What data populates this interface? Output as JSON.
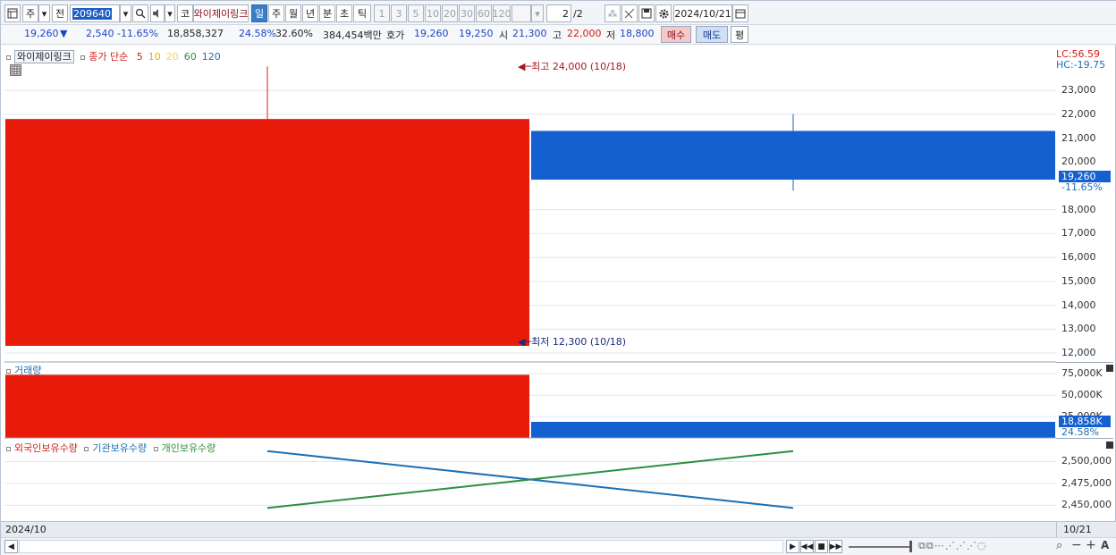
{
  "toolbar": {
    "market_type": "주",
    "prev_label": "전",
    "code": "209640",
    "name_prefix": "코",
    "stock_name": "와이제이링크",
    "periods": [
      "일",
      "주",
      "월",
      "년",
      "분",
      "초",
      "틱"
    ],
    "active_period": "일",
    "intervals": [
      "1",
      "3",
      "5",
      "10",
      "20",
      "30",
      "60",
      "120"
    ],
    "page": "2",
    "page_total": "/2",
    "date": "2024/10/21"
  },
  "quote": {
    "price": "19,260",
    "change_arrow": "▼",
    "change": "2,540",
    "change_pct": "-11.65%",
    "volume": "18,858,327",
    "turnover_pct": "24.58%",
    "ratio_pct": "32.60%",
    "amount": "384,454백만",
    "bid_label": "호가",
    "bid1": "19,260",
    "bid2": "19,250",
    "open_label": "시",
    "open": "21,300",
    "high_label": "고",
    "high": "22,000",
    "low_label": "저",
    "low": "18,800",
    "buy_label": "매수",
    "sell_label": "매도",
    "avg_label": "평"
  },
  "price_panel": {
    "legend_name": "와이제이링크",
    "legend_series": "종가 단순",
    "ma": [
      {
        "label": "5",
        "color": "#d0201c"
      },
      {
        "label": "10",
        "color": "#e3b400"
      },
      {
        "label": "20",
        "color": "#f0d84a"
      },
      {
        "label": "60",
        "color": "#2b8f3f"
      },
      {
        "label": "120",
        "color": "#1b6fb5"
      }
    ],
    "high_note": "최고 24,000 (10/18)",
    "low_note": "최저 12,300 (10/18)",
    "lc": "LC:56.59",
    "hc": "HC:-19.75",
    "current_price_tag": "19,260",
    "current_pct_tag": "-11.65%",
    "y_ticks": [
      "23,000",
      "22,000",
      "21,000",
      "20,000",
      "18,000",
      "17,000",
      "16,000",
      "15,000",
      "14,000",
      "13,000",
      "12,000"
    ]
  },
  "volume_panel": {
    "title": "거래량",
    "y_ticks": [
      "75,000K",
      "50,000K",
      "25,000K"
    ],
    "current_tag": "18,858K",
    "current_pct": "24.58%"
  },
  "holdings_panel": {
    "series": [
      {
        "label": "외국인보유수량",
        "color": "#d0201c"
      },
      {
        "label": "기관보유수량",
        "color": "#1b6fb5"
      },
      {
        "label": "개인보유수량",
        "color": "#2b8f3f"
      }
    ],
    "y_ticks": [
      "2,500,000",
      "2,475,000",
      "2,450,000"
    ]
  },
  "date_axis": {
    "left": "2024/10",
    "right": "10/21"
  },
  "chart_data": {
    "type": "candlestick",
    "dates": [
      "10/18",
      "10/21"
    ],
    "candles": [
      {
        "date": "10/18",
        "open": 12300,
        "high": 24000,
        "low": 12300,
        "close": 21800,
        "color": "#e81a0a"
      },
      {
        "date": "10/21",
        "open": 21300,
        "high": 22000,
        "low": 18800,
        "close": 19260,
        "color": "#1560d0"
      }
    ],
    "ylim": [
      11700,
      24800
    ],
    "volume": {
      "values": [
        74000,
        18858
      ],
      "ylim": [
        0,
        88000
      ]
    },
    "holdings": {
      "institution": [
        2512000,
        2447000
      ],
      "individual": [
        2447000,
        2512000
      ],
      "ylim": [
        2432000,
        2526000
      ]
    }
  }
}
